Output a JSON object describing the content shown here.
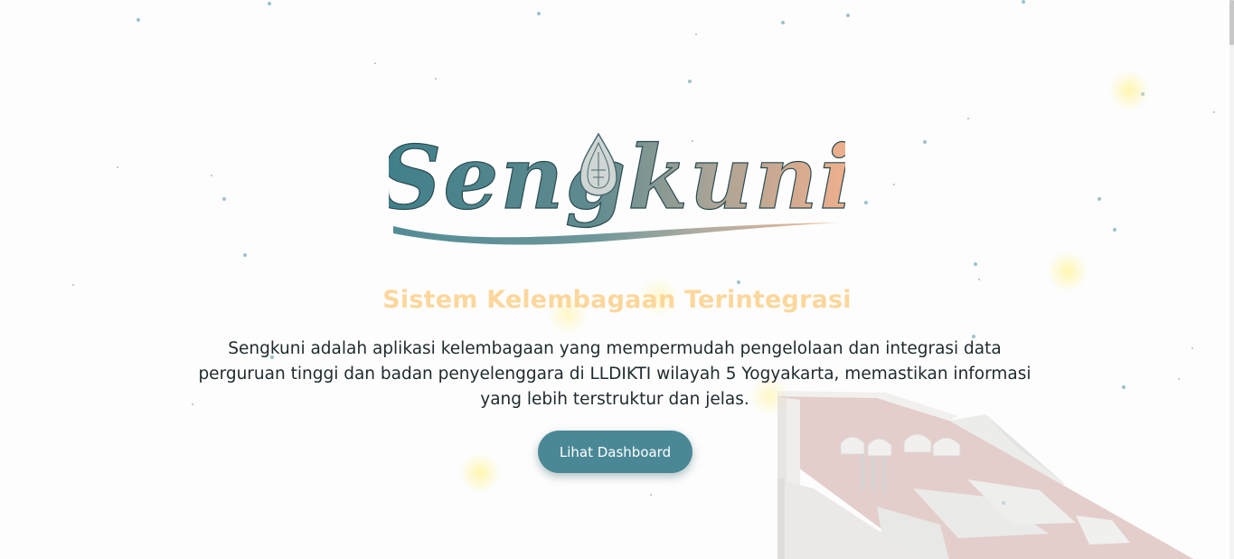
{
  "hero": {
    "logo_text": "Sengkuni",
    "tagline": "Sistem Kelembagaan Terintegrasi",
    "description": "Sengkuni adalah aplikasi kelembagaan yang mempermudah pengelolaan dan integrasi data perguruan tinggi dan badan penyelenggara di LLDIKTI wilayah 5 Yogyakarta, memastikan informasi yang lebih terstruktur dan jelas.",
    "cta_label": "Lihat Dashboard"
  },
  "colors": {
    "tagline": "#fcd79c",
    "button": "#4a8896",
    "logo_start": "#3f7f8a",
    "logo_end": "#f2b08c"
  },
  "icons": {
    "logo_ornament": "gunungan-ornament-icon",
    "background_illustration": "building-illustration"
  }
}
